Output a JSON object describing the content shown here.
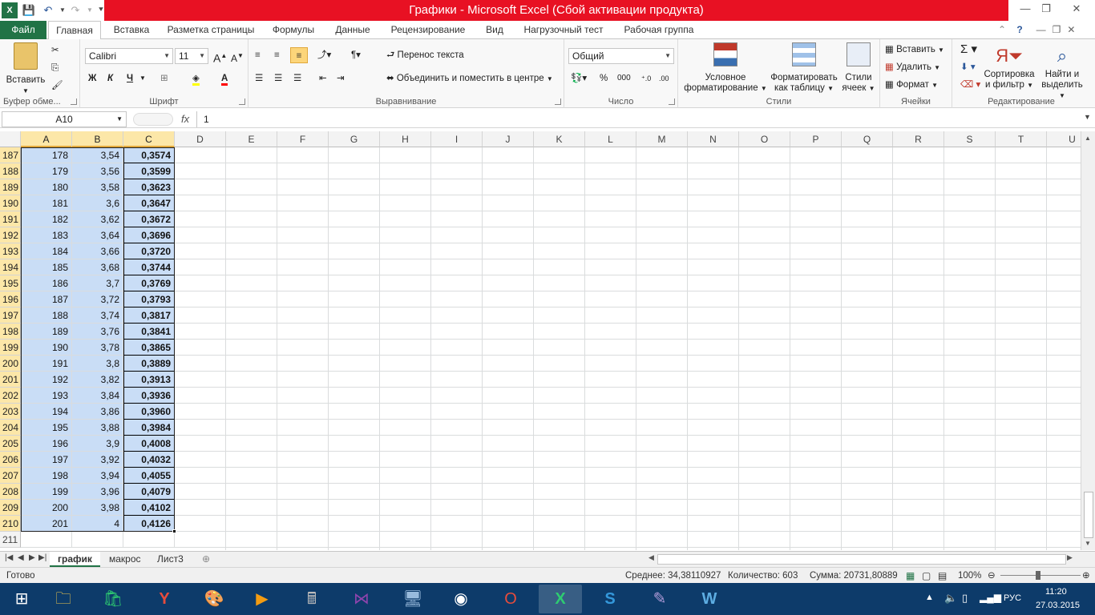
{
  "window": {
    "title": "Графики - Microsoft Excel (Сбой активации продукта)",
    "help_icon": "?",
    "min": "—",
    "restore": "❐",
    "close": "✕"
  },
  "tabs": [
    "Файл",
    "Главная",
    "Вставка",
    "Разметка страницы",
    "Формулы",
    "Данные",
    "Рецензирование",
    "Вид",
    "Нагрузочный тест",
    "Рабочая группа"
  ],
  "ribbon": {
    "clipboard": {
      "label": "Буфер обме...",
      "paste": "Вставить"
    },
    "font": {
      "label": "Шрифт",
      "name": "Calibri",
      "size": "11",
      "bold": "Ж",
      "italic": "К",
      "underline": "Ч"
    },
    "alignment": {
      "label": "Выравнивание",
      "wrap": "Перенос текста",
      "merge": "Объединить и поместить в центре"
    },
    "number": {
      "label": "Число",
      "format": "Общий",
      "percent": "%",
      "thousands": "000"
    },
    "styles": {
      "label": "Стили",
      "cond1": "Условное",
      "cond2": "форматирование",
      "table1": "Форматировать",
      "table2": "как таблицу",
      "cell1": "Стили",
      "cell2": "ячеек"
    },
    "cells": {
      "label": "Ячейки",
      "insert": "Вставить",
      "delete": "Удалить",
      "format": "Формат"
    },
    "editing": {
      "label": "Редактирование",
      "sort1": "Сортировка",
      "sort2": "и фильтр",
      "find1": "Найти и",
      "find2": "выделить"
    }
  },
  "formula_bar": {
    "name_box": "A10",
    "fx": "fx",
    "value": "1"
  },
  "columns": [
    "A",
    "B",
    "C",
    "D",
    "E",
    "F",
    "G",
    "H",
    "I",
    "J",
    "K",
    "L",
    "M",
    "N",
    "O",
    "P",
    "Q",
    "R",
    "S",
    "T",
    "U"
  ],
  "rows": [
    {
      "n": "187",
      "a": "178",
      "b": "3,54",
      "c": "0,3574"
    },
    {
      "n": "188",
      "a": "179",
      "b": "3,56",
      "c": "0,3599"
    },
    {
      "n": "189",
      "a": "180",
      "b": "3,58",
      "c": "0,3623"
    },
    {
      "n": "190",
      "a": "181",
      "b": "3,6",
      "c": "0,3647"
    },
    {
      "n": "191",
      "a": "182",
      "b": "3,62",
      "c": "0,3672"
    },
    {
      "n": "192",
      "a": "183",
      "b": "3,64",
      "c": "0,3696"
    },
    {
      "n": "193",
      "a": "184",
      "b": "3,66",
      "c": "0,3720"
    },
    {
      "n": "194",
      "a": "185",
      "b": "3,68",
      "c": "0,3744"
    },
    {
      "n": "195",
      "a": "186",
      "b": "3,7",
      "c": "0,3769"
    },
    {
      "n": "196",
      "a": "187",
      "b": "3,72",
      "c": "0,3793"
    },
    {
      "n": "197",
      "a": "188",
      "b": "3,74",
      "c": "0,3817"
    },
    {
      "n": "198",
      "a": "189",
      "b": "3,76",
      "c": "0,3841"
    },
    {
      "n": "199",
      "a": "190",
      "b": "3,78",
      "c": "0,3865"
    },
    {
      "n": "200",
      "a": "191",
      "b": "3,8",
      "c": "0,3889"
    },
    {
      "n": "201",
      "a": "192",
      "b": "3,82",
      "c": "0,3913"
    },
    {
      "n": "202",
      "a": "193",
      "b": "3,84",
      "c": "0,3936"
    },
    {
      "n": "203",
      "a": "194",
      "b": "3,86",
      "c": "0,3960"
    },
    {
      "n": "204",
      "a": "195",
      "b": "3,88",
      "c": "0,3984"
    },
    {
      "n": "205",
      "a": "196",
      "b": "3,9",
      "c": "0,4008"
    },
    {
      "n": "206",
      "a": "197",
      "b": "3,92",
      "c": "0,4032"
    },
    {
      "n": "207",
      "a": "198",
      "b": "3,94",
      "c": "0,4055"
    },
    {
      "n": "208",
      "a": "199",
      "b": "3,96",
      "c": "0,4079"
    },
    {
      "n": "209",
      "a": "200",
      "b": "3,98",
      "c": "0,4102"
    },
    {
      "n": "210",
      "a": "201",
      "b": "4",
      "c": "0,4126"
    },
    {
      "n": "211",
      "a": "",
      "b": "",
      "c": ""
    }
  ],
  "sheets": [
    "график",
    "макрос",
    "Лист3"
  ],
  "status": {
    "ready": "Готово",
    "average": "Среднее: 34,38110927",
    "count": "Количество: 603",
    "sum": "Сумма: 20731,80889",
    "zoom": "100%"
  },
  "taskbar": {
    "lang": "РУС",
    "time": "11:20",
    "date": "27.03.2015"
  },
  "colors": {
    "excel_green": "#217346",
    "title_red": "#e81123",
    "selection": "#c9ddf6",
    "taskbar": "#0d3b6a"
  }
}
